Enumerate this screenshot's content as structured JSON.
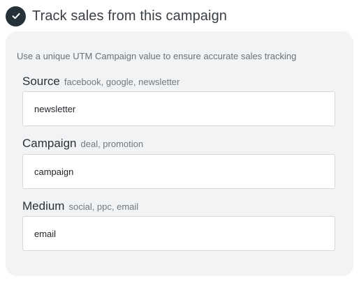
{
  "header": {
    "title": "Track sales from this campaign",
    "checked": true,
    "icon": "check-icon"
  },
  "panel": {
    "help_text": "Use a unique UTM Campaign value to ensure accurate sales tracking"
  },
  "fields": {
    "source": {
      "label": "Source",
      "hint": "facebook, google, newsletter",
      "value": "newsletter"
    },
    "campaign": {
      "label": "Campaign",
      "hint": "deal, promotion",
      "value": "campaign"
    },
    "medium": {
      "label": "Medium",
      "hint": "social, ppc, email",
      "value": "email"
    }
  },
  "colors": {
    "checkbox_fill": "#26323a",
    "panel_background": "#f2f3f5",
    "input_border": "#d6d9dc"
  }
}
